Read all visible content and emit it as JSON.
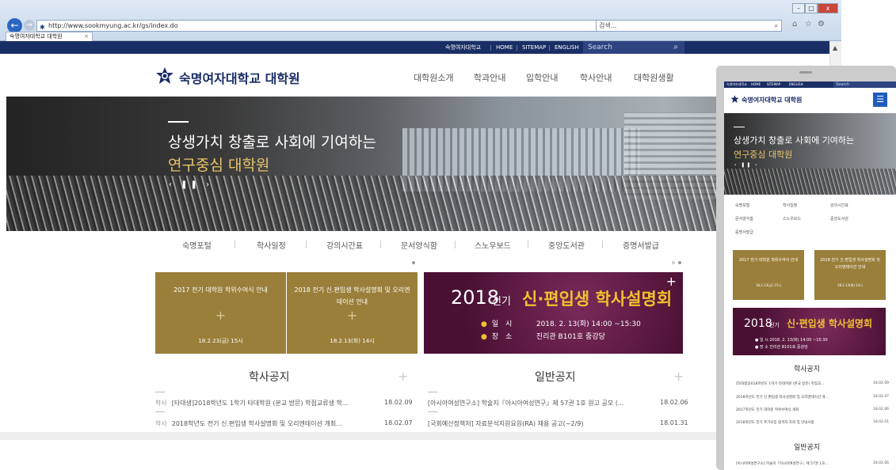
{
  "browser": {
    "url": "http://www.sookmyung.ac.kr/gs/index.do",
    "url_controls": "▾ C",
    "search_placeholder": "검색...",
    "tab_title": "숙명여자대학교 대학원",
    "tab_close": "×",
    "back": "←",
    "forward": "→",
    "min": "–",
    "max": "□",
    "close": "x",
    "tools": [
      "⌂",
      "☆",
      "⚙"
    ]
  },
  "topbar": {
    "links": [
      "숙명여자대학교",
      "HOME",
      "SITEMAP",
      "ENGLISH"
    ],
    "search_placeholder": "Search"
  },
  "header": {
    "logo_text": "숙명여자대학교 대학원",
    "nav": [
      "대학원소개",
      "학과안내",
      "입학안내",
      "학사안내",
      "대학원생활"
    ]
  },
  "hero": {
    "line1": "상생가치 창출로 사회에 기여하는",
    "line2": "연구중심 대학원",
    "controls": "‹ ❚❚ ›"
  },
  "quick_links": [
    "숙명포털",
    "학사일정",
    "강의시간표",
    "문서양식함",
    "스노우보드",
    "중앙도서관",
    "증명서발급"
  ],
  "gold_boxes": [
    {
      "title": "2017 전기 대학원 학위수여식 안내",
      "plus": "+",
      "date": "18.2.23(금) 15시"
    },
    {
      "title": "2018 전기 신.편입생 학사설명회 및 오리엔테이션 안내",
      "plus": "+",
      "date": "18.2.13(화) 14시"
    }
  ],
  "banner": {
    "year": "2018",
    "sem": "전기",
    "title": "신·편입생 학사설명회",
    "plus": "+",
    "rows": [
      {
        "bullet": "●",
        "key": "일 시",
        "val": "2018. 2. 13(화) 14:00 ~15:30"
      },
      {
        "bullet": "●",
        "key": "장 소",
        "val": "진리관 B101호 중강당"
      }
    ]
  },
  "academic": {
    "heading": "학사공지",
    "plus": "+",
    "items": [
      {
        "cat": "학사",
        "title": "[타대생]2018학년도 1학기 타대학원 (본교 방문) 학점교류생 학...",
        "date": "18.02.09"
      },
      {
        "cat": "학사",
        "title": "2018학년도 전기 신.편입생 학사설명회 및 오리엔테이션 개최...",
        "date": "18.02.07"
      }
    ]
  },
  "general": {
    "heading": "일반공지",
    "plus": "+",
    "items": [
      {
        "title": "[아시아여성연구소] 학술지『아시아여성연구』제 57권 1호 원고 공모 (...",
        "date": "18.02.06"
      },
      {
        "title": "[국회예산정책처] 자료분석지원요원(RA) 채용 공고(~2/9)",
        "date": "18.01.31"
      }
    ]
  },
  "mobile": {
    "topbar": [
      "숙명여자대학교",
      "HOME",
      "SITEMAP",
      "ENGLISH"
    ],
    "search": "Search",
    "logo_text": "숙명여자대학교 대학원",
    "menu_icon": "☰",
    "hero_line1": "상생가치 창출로 사회에 기여하는",
    "hero_line2": "연구중심 대학원",
    "hero_controls": "‹ ❚❚ ›",
    "quick_links": [
      "숙명포털",
      "학사일정",
      "강의시간표",
      "문서양식함",
      "스노우보드",
      "중앙도서관",
      "증명서발급"
    ],
    "gold_boxes": [
      {
        "title": "2017 전기 대학원 학위수여식 안내",
        "date": "18.2.23(금) 15시"
      },
      {
        "title": "2018 전기 신.편입생 학사설명회 및 오리엔테이션 안내",
        "date": "18.2.13(화) 14시"
      }
    ],
    "banner_year": "2018",
    "banner_sem": "전기",
    "banner_title": "신·편입생 학사설명회",
    "banner_rows": [
      "● 일 시   2018. 2. 13(화) 14:00 ~15:30",
      "● 장 소   진리관 B101호 중강당"
    ],
    "academic_heading": "학사공지",
    "academic_items": [
      {
        "title": "[타대생]2018학년도 1학기 타대학원 (본교 방문) 학점교...",
        "date": "18.02.09"
      },
      {
        "title": "2018학년도 전기 신.편입생 학사설명회 및 오리엔테이션 개...",
        "date": "18.02.07"
      },
      {
        "title": "2017학년도 전기 대학원 학위수여식 개최",
        "date": "18.02.06"
      },
      {
        "title": "2018학년도 전기 추가모집 합격자 조회 및 안내사항",
        "date": "18.02.01"
      }
    ],
    "general_heading": "일반공지",
    "general_items": [
      {
        "title": "[아시아여성연구소] 학술지『아시아여성연구』제 57권 1호...",
        "date": "18.02.06"
      }
    ]
  },
  "colors": {
    "navy": "#1a2e66",
    "gold": "#9a7f3a",
    "banner": "#5a1840",
    "accent": "#f2c12e"
  }
}
